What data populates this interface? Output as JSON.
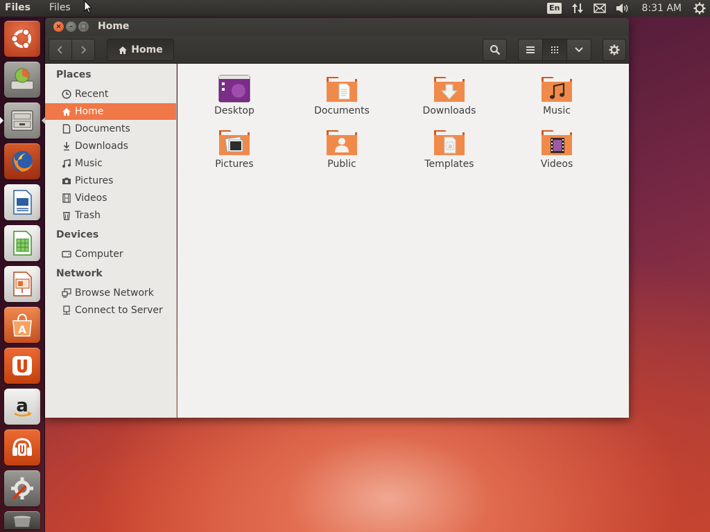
{
  "top_panel": {
    "app_name": "Files",
    "menu_label": "Files",
    "keyboard_layout": "En",
    "clock": "8:31 AM"
  },
  "launcher": {
    "items": [
      {
        "icon": "ubuntu-dash-icon"
      },
      {
        "icon": "disk-usage-icon"
      },
      {
        "icon": "files-icon",
        "active": true
      },
      {
        "icon": "firefox-icon"
      },
      {
        "icon": "libreoffice-writer-icon"
      },
      {
        "icon": "libreoffice-calc-icon"
      },
      {
        "icon": "libreoffice-impress-icon"
      },
      {
        "icon": "software-center-icon"
      },
      {
        "icon": "ubuntu-one-icon"
      },
      {
        "icon": "amazon-icon"
      },
      {
        "icon": "ubuntu-one-music-icon"
      },
      {
        "icon": "system-settings-icon"
      },
      {
        "icon": "trash-icon"
      }
    ]
  },
  "window": {
    "title": "Home",
    "path_button": "Home"
  },
  "sidebar": {
    "places_header": "Places",
    "places": [
      {
        "label": "Recent",
        "icon": "clock-icon"
      },
      {
        "label": "Home",
        "icon": "home-icon",
        "selected": true
      },
      {
        "label": "Documents",
        "icon": "document-icon"
      },
      {
        "label": "Downloads",
        "icon": "download-icon"
      },
      {
        "label": "Music",
        "icon": "music-icon"
      },
      {
        "label": "Pictures",
        "icon": "camera-icon"
      },
      {
        "label": "Videos",
        "icon": "film-icon"
      },
      {
        "label": "Trash",
        "icon": "trash-icon"
      }
    ],
    "devices_header": "Devices",
    "devices": [
      {
        "label": "Computer",
        "icon": "drive-icon"
      }
    ],
    "network_header": "Network",
    "network": [
      {
        "label": "Browse Network",
        "icon": "network-icon"
      },
      {
        "label": "Connect to Server",
        "icon": "server-icon"
      }
    ]
  },
  "files": [
    {
      "label": "Desktop",
      "icon": "desktop-folder-icon"
    },
    {
      "label": "Documents",
      "icon": "documents-folder-icon"
    },
    {
      "label": "Downloads",
      "icon": "downloads-folder-icon"
    },
    {
      "label": "Music",
      "icon": "music-folder-icon"
    },
    {
      "label": "Pictures",
      "icon": "pictures-folder-icon"
    },
    {
      "label": "Public",
      "icon": "public-folder-icon"
    },
    {
      "label": "Templates",
      "icon": "templates-folder-icon"
    },
    {
      "label": "Videos",
      "icon": "videos-folder-icon"
    }
  ],
  "colors": {
    "accent": "#f07746",
    "panel": "#3c3b37",
    "sidebar_bg": "#ebe9e6",
    "content_bg": "#f2f1f0"
  }
}
